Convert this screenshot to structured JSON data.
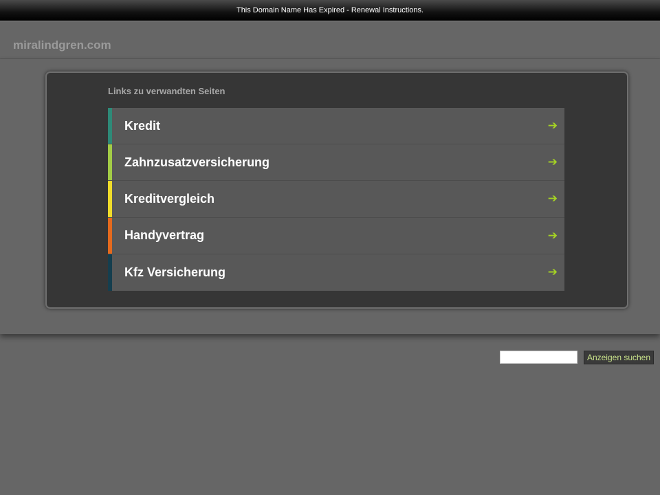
{
  "topbar": {
    "notice": "This Domain Name Has Expired - Renewal Instructions."
  },
  "header": {
    "domain": "miralindgren.com"
  },
  "links": {
    "title": "Links zu verwandten Seiten",
    "items": [
      {
        "label": "Kredit",
        "accent": "#2e8a78",
        "arrow": "➔"
      },
      {
        "label": "Zahnzusatzversicherung",
        "accent": "#a3cc46",
        "arrow": "➔"
      },
      {
        "label": "Kreditvergleich",
        "accent": "#f0dc2a",
        "arrow": "➔"
      },
      {
        "label": "Handyvertrag",
        "accent": "#e56a1e",
        "arrow": "➔"
      },
      {
        "label": "Kfz Versicherung",
        "accent": "#153e4e",
        "arrow": "➔"
      }
    ]
  },
  "search": {
    "value": "",
    "button_label": "Anzeigen suchen"
  },
  "colors": {
    "arrow": "#a5d323",
    "background": "#666666",
    "panel": "#363636"
  }
}
